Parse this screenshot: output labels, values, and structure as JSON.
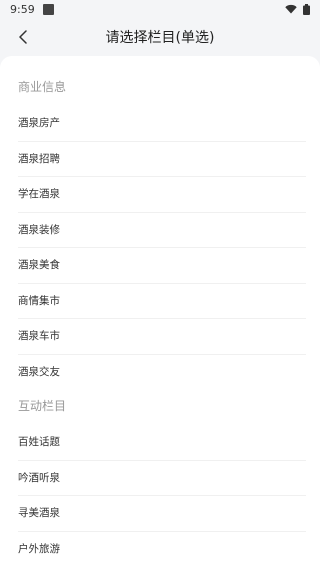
{
  "status": {
    "time": "9:59"
  },
  "header": {
    "title": "请选择栏目(单选)"
  },
  "groups": [
    {
      "title": "商业信息",
      "items": [
        "酒泉房产",
        "酒泉招聘",
        "学在酒泉",
        "酒泉装修",
        "酒泉美食",
        "商情集市",
        "酒泉车市",
        "酒泉交友"
      ]
    },
    {
      "title": "互动栏目",
      "items": [
        "百姓话题",
        "吟酒听泉",
        "寻美酒泉",
        "户外旅游"
      ]
    }
  ]
}
